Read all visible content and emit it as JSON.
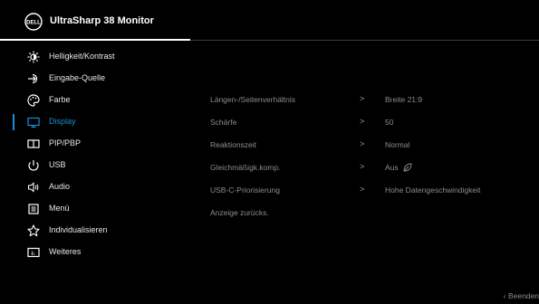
{
  "header": {
    "title": "UltraSharp 38 Monitor",
    "logo": "DELL"
  },
  "menu": {
    "items": [
      {
        "label": "Helligkeit/Kontrast",
        "icon": "brightness-icon"
      },
      {
        "label": "Eingabe-Quelle",
        "icon": "input-source-icon"
      },
      {
        "label": "Farbe",
        "icon": "color-icon"
      },
      {
        "label": "Display",
        "icon": "display-icon"
      },
      {
        "label": "PIP/PBP",
        "icon": "pip-pbp-icon"
      },
      {
        "label": "USB",
        "icon": "usb-icon"
      },
      {
        "label": "Audio",
        "icon": "audio-icon"
      },
      {
        "label": "Menü",
        "icon": "menu-icon"
      },
      {
        "label": "Individualisieren",
        "icon": "star-icon"
      },
      {
        "label": "Weiteres",
        "icon": "others-icon"
      }
    ],
    "active": "Display"
  },
  "settings": {
    "rows": [
      {
        "label": "Längen-/Seitenverhältnis",
        "value": "Breite 21:9",
        "chevron": ">"
      },
      {
        "label": "Schärfe",
        "value": "50",
        "chevron": ">"
      },
      {
        "label": "Reaktionszeit",
        "value": "Normal",
        "chevron": ">"
      },
      {
        "label": "Gleichmäßigk.komp.",
        "value": "Aus",
        "chevron": ">",
        "value_icon": "leaf-icon"
      },
      {
        "label": "USB-C-Priorisierung",
        "value": "Hohe Datengeschwindigkeit",
        "chevron": ">"
      },
      {
        "label": "Anzeige zurücks.",
        "value": "",
        "chevron": ""
      }
    ]
  },
  "footer": {
    "exit_label": "Beenden",
    "exit_icon": "chevron-left-icon"
  },
  "colors": {
    "accent": "#1a8fd8",
    "background": "#000000",
    "inactive_text": "#8c8c8c"
  }
}
